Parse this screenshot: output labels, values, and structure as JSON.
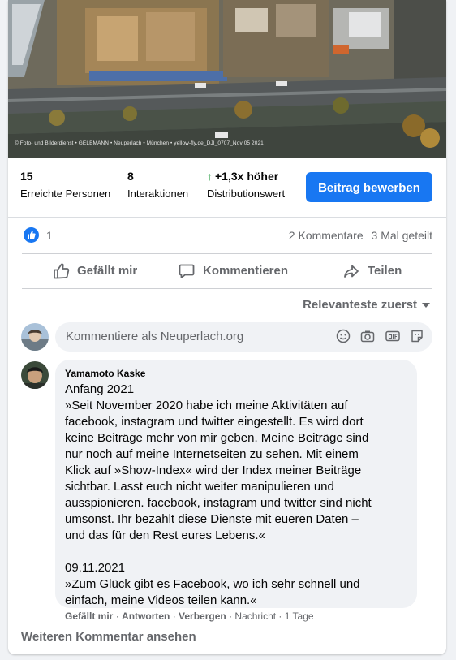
{
  "photo": {
    "credit": "© Foto- und Bilderdienst • GELBMANN • Neuperlach • München • yellow-fly.de_DJI_0707_Nov 05 2021"
  },
  "stats": {
    "reach": {
      "value": "15",
      "label": "Erreichte Personen"
    },
    "interactions": {
      "value": "8",
      "label": "Interaktionen"
    },
    "distribution": {
      "value": "+1,3x höher",
      "label": "Distributionswert"
    },
    "promote_label": "Beitrag bewerben"
  },
  "reactions": {
    "like_count": "1",
    "comments": "2 Kommentare",
    "shares": "3 Mal geteilt"
  },
  "actions": {
    "like": "Gefällt mir",
    "comment": "Kommentieren",
    "share": "Teilen"
  },
  "sort": {
    "label": "Relevanteste zuerst"
  },
  "composer": {
    "placeholder": "Kommentiere als Neuperlach.org"
  },
  "comment": {
    "author": "Yamamoto Kaske",
    "lines": [
      "Anfang 2021",
      "»Seit November 2020 habe ich meine Aktivitäten auf",
      "facebook, instagram und twitter eingestellt. Es wird dort",
      "keine Beiträge mehr von mir geben. Meine Beiträge sind",
      "nur noch auf meine Internetseiten zu sehen. Mit einem",
      "Klick auf »Show-Index« wird der Index meiner Beiträge",
      "sichtbar. Lasst euch nicht weiter manipulieren und",
      "ausspionieren. facebook, instagram und twitter sind nicht",
      "umsonst. Ihr bezahlt diese Dienste mit eueren Daten –",
      "und das für den Rest eures Lebens.«",
      "",
      "09.11.2021",
      "»Zum Glück gibt es Facebook, wo ich sehr schnell und",
      "einfach, meine Videos teilen kann.«"
    ],
    "footer": {
      "like": "Gefällt mir",
      "reply": "Antworten",
      "hide": "Verbergen",
      "message": "Nachricht",
      "time": "1 Tage",
      "sep": " · "
    }
  },
  "more_comments": "Weiteren Kommentar ansehen",
  "colors": {
    "accent": "#1877f2",
    "positive": "#31a24c",
    "muted": "#65676b"
  }
}
